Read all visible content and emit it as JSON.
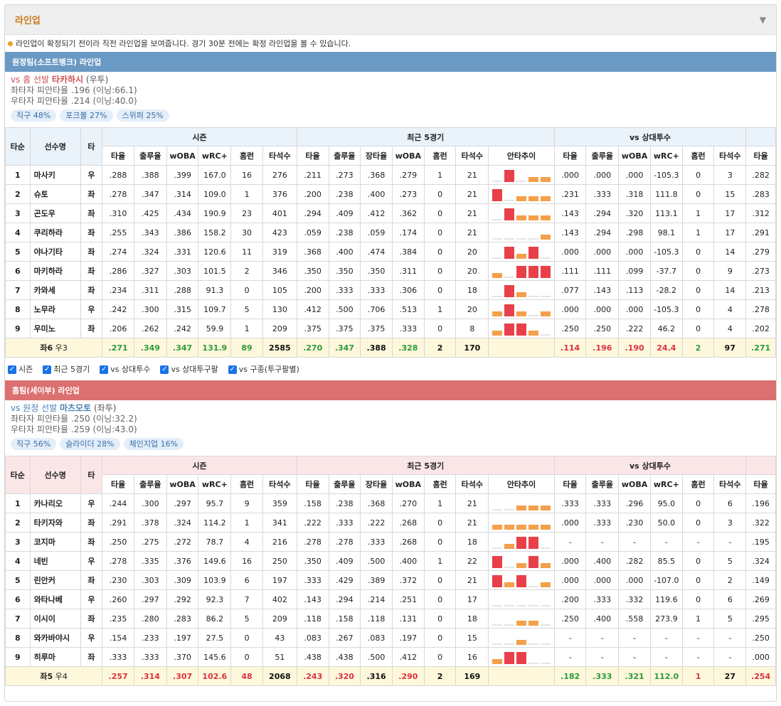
{
  "panel": {
    "title": "라인업",
    "caret": "▼"
  },
  "notice": "라인업이 확정되기 전이라 직전 라인업을 보여줍니다. 경기 30분 전에는 확정 라인업을 볼 수 있습니다.",
  "headers": {
    "order": "타순",
    "name": "선수명",
    "bat": "타",
    "season": "시즌",
    "recent": "최근 5경기",
    "vs_pitcher": "vs 상대투수",
    "season_cols": [
      "타율",
      "출루율",
      "wOBA",
      "wRC+",
      "홈런",
      "타석수"
    ],
    "recent_cols": [
      "타율",
      "출루율",
      "장타율",
      "wOBA",
      "홈런",
      "타석수",
      "안타추이"
    ],
    "vs_cols": [
      "타율",
      "출루율",
      "wOBA",
      "wRC+",
      "홈런",
      "타석수"
    ],
    "extra_col": "타율"
  },
  "colors": {
    "away_bar": "#6a99c4",
    "home_bar": "#dc7070",
    "away_head": "#eaf2fa",
    "home_head": "#fbe6e7",
    "hit_high": "#e8404a",
    "hit_low": "#f4a04a",
    "hit_zero": "#e4e4e4"
  },
  "away": {
    "bar": "원정팀(소프트뱅크) 라인업",
    "vs_prefix": "vs 홈 선발 ",
    "pitcher": "타카하시",
    "pitcher_hand": "(우투)",
    "left_line": "좌타자 피안타율 .196 (이닝:66.1)",
    "right_line": "우타자 피안타율 .214 (이닝:40.0)",
    "pills": [
      "직구 48%",
      "포크볼 27%",
      "스위퍼 25%"
    ],
    "rows": [
      [
        "1",
        "마사키",
        "우",
        ".288",
        ".388",
        ".399",
        "167.0",
        "16",
        "276",
        ".211",
        ".273",
        ".368",
        ".279",
        "1",
        "21",
        ".000",
        ".000",
        ".000",
        "-105.3",
        "0",
        "3",
        ".282"
      ],
      [
        "2",
        "슈토",
        "좌",
        ".278",
        ".347",
        ".314",
        "109.0",
        "1",
        "376",
        ".200",
        ".238",
        ".400",
        ".273",
        "0",
        "21",
        ".231",
        ".333",
        ".318",
        "111.8",
        "0",
        "15",
        ".283"
      ],
      [
        "3",
        "곤도우",
        "좌",
        ".310",
        ".425",
        ".434",
        "190.9",
        "23",
        "401",
        ".294",
        ".409",
        ".412",
        ".362",
        "0",
        "21",
        ".143",
        ".294",
        ".320",
        "113.1",
        "1",
        "17",
        ".312"
      ],
      [
        "4",
        "쿠리하라",
        "좌",
        ".255",
        ".343",
        ".386",
        "158.2",
        "30",
        "423",
        ".059",
        ".238",
        ".059",
        ".174",
        "0",
        "21",
        ".143",
        ".294",
        ".298",
        "98.1",
        "1",
        "17",
        ".291"
      ],
      [
        "5",
        "야나기타",
        "좌",
        ".274",
        ".324",
        ".331",
        "120.6",
        "11",
        "319",
        ".368",
        ".400",
        ".474",
        ".384",
        "0",
        "20",
        ".000",
        ".000",
        ".000",
        "-105.3",
        "0",
        "14",
        ".279"
      ],
      [
        "6",
        "마키하라",
        "좌",
        ".286",
        ".327",
        ".303",
        "101.5",
        "2",
        "346",
        ".350",
        ".350",
        ".350",
        ".311",
        "0",
        "20",
        ".111",
        ".111",
        ".099",
        "-37.7",
        "0",
        "9",
        ".273"
      ],
      [
        "7",
        "카와세",
        "좌",
        ".234",
        ".311",
        ".288",
        "91.3",
        "0",
        "105",
        ".200",
        ".333",
        ".333",
        ".306",
        "0",
        "18",
        ".077",
        ".143",
        ".113",
        "-28.2",
        "0",
        "14",
        ".213"
      ],
      [
        "8",
        "노무라",
        "우",
        ".242",
        ".300",
        ".315",
        "109.7",
        "5",
        "130",
        ".412",
        ".500",
        ".706",
        ".513",
        "1",
        "20",
        ".000",
        ".000",
        ".000",
        "-105.3",
        "0",
        "4",
        ".278"
      ],
      [
        "9",
        "우미노",
        "좌",
        ".206",
        ".262",
        ".242",
        "59.9",
        "1",
        "209",
        ".375",
        ".375",
        ".375",
        ".333",
        "0",
        "8",
        ".250",
        ".250",
        ".222",
        "46.2",
        "0",
        "4",
        ".202"
      ]
    ],
    "hits": [
      [
        0,
        3,
        0,
        1,
        1
      ],
      [
        3,
        0,
        1,
        1,
        1
      ],
      [
        0,
        3,
        1,
        1,
        1
      ],
      [
        0,
        0,
        0,
        0,
        1
      ],
      [
        0,
        3,
        1,
        3,
        0
      ],
      [
        1,
        0,
        3,
        3,
        3
      ],
      [
        0,
        3,
        1,
        0,
        0
      ],
      [
        1,
        3,
        1,
        0,
        1
      ],
      [
        1,
        3,
        3,
        1,
        0
      ]
    ],
    "total_label": {
      "prefix": "좌",
      "left": "6",
      "mid": " 우",
      "right": "3"
    },
    "total": [
      ".271",
      ".349",
      ".347",
      "131.9",
      "89",
      "2585",
      ".270",
      ".347",
      ".388",
      ".328",
      "2",
      "170",
      ".114",
      ".196",
      ".190",
      "24.4",
      "2",
      "97",
      ".271"
    ],
    "total_color": [
      "pos",
      "pos",
      "pos",
      "pos",
      "pos",
      "blk",
      "pos",
      "pos",
      "blk",
      "pos",
      "blk",
      "blk",
      "neg",
      "neg",
      "neg",
      "neg",
      "pos",
      "blk",
      "pos"
    ]
  },
  "checkboxes": [
    "시즌",
    "최근 5경기",
    "vs 상대투수",
    "vs 상대투구팔",
    "vs 구종(투구팔별)"
  ],
  "home": {
    "bar": "홈팀(세이부) 라인업",
    "vs_prefix": "vs 원정 선발 ",
    "pitcher": "마츠모토",
    "pitcher_hand": "(좌투)",
    "left_line": "좌타자 피안타율 .250 (이닝:32.2)",
    "right_line": "우타자 피안타율 .259 (이닝:43.0)",
    "pills": [
      "직구 56%",
      "슬라이더 28%",
      "체인지업 16%"
    ],
    "rows": [
      [
        "1",
        "카나리오",
        "우",
        ".244",
        ".300",
        ".297",
        "95.7",
        "9",
        "359",
        ".158",
        ".238",
        ".368",
        ".270",
        "1",
        "21",
        ".333",
        ".333",
        ".296",
        "95.0",
        "0",
        "6",
        ".196"
      ],
      [
        "2",
        "타키자와",
        "좌",
        ".291",
        ".378",
        ".324",
        "114.2",
        "1",
        "341",
        ".222",
        ".333",
        ".222",
        ".268",
        "0",
        "21",
        ".000",
        ".333",
        ".230",
        "50.0",
        "0",
        "3",
        ".322"
      ],
      [
        "3",
        "코지마",
        "좌",
        ".250",
        ".275",
        ".272",
        "78.7",
        "4",
        "216",
        ".278",
        ".278",
        ".333",
        ".268",
        "0",
        "18",
        "-",
        "-",
        "-",
        "-",
        "-",
        "-",
        ".195"
      ],
      [
        "4",
        "네빈",
        "우",
        ".278",
        ".335",
        ".376",
        "149.6",
        "16",
        "250",
        ".350",
        ".409",
        ".500",
        ".400",
        "1",
        "22",
        ".000",
        ".400",
        ".282",
        "85.5",
        "0",
        "5",
        ".324"
      ],
      [
        "5",
        "린안커",
        "좌",
        ".230",
        ".303",
        ".309",
        "103.9",
        "6",
        "197",
        ".333",
        ".429",
        ".389",
        ".372",
        "0",
        "21",
        ".000",
        ".000",
        ".000",
        "-107.0",
        "0",
        "2",
        ".149"
      ],
      [
        "6",
        "와타나베",
        "우",
        ".260",
        ".297",
        ".292",
        "92.3",
        "7",
        "402",
        ".143",
        ".294",
        ".214",
        ".251",
        "0",
        "17",
        ".200",
        ".333",
        ".332",
        "119.6",
        "0",
        "6",
        ".269"
      ],
      [
        "7",
        "이시이",
        "좌",
        ".235",
        ".280",
        ".283",
        "86.2",
        "5",
        "209",
        ".118",
        ".158",
        ".118",
        ".131",
        "0",
        "18",
        ".250",
        ".400",
        ".558",
        "273.9",
        "1",
        "5",
        ".295"
      ],
      [
        "8",
        "와카바야시",
        "우",
        ".154",
        ".233",
        ".197",
        "27.5",
        "0",
        "43",
        ".083",
        ".267",
        ".083",
        ".197",
        "0",
        "15",
        "-",
        "-",
        "-",
        "-",
        "-",
        "-",
        ".250"
      ],
      [
        "9",
        "히루마",
        "좌",
        ".333",
        ".333",
        ".370",
        "145.6",
        "0",
        "51",
        ".438",
        ".438",
        ".500",
        ".412",
        "0",
        "16",
        "-",
        "-",
        "-",
        "-",
        "-",
        "-",
        ".000"
      ]
    ],
    "hits": [
      [
        0,
        0,
        1,
        1,
        1
      ],
      [
        1,
        1,
        1,
        1,
        1
      ],
      [
        0,
        1,
        3,
        3,
        0
      ],
      [
        3,
        0,
        1,
        3,
        1
      ],
      [
        3,
        1,
        3,
        0,
        1
      ],
      [
        0,
        0,
        0,
        0,
        0
      ],
      [
        0,
        0,
        1,
        1,
        0
      ],
      [
        0,
        0,
        1,
        0,
        0
      ],
      [
        1,
        3,
        3,
        0,
        0
      ]
    ],
    "total_label": {
      "prefix": "좌",
      "left": "5",
      "mid": " 우",
      "right": "4"
    },
    "total": [
      ".257",
      ".314",
      ".307",
      "102.6",
      "48",
      "2068",
      ".243",
      ".320",
      ".316",
      ".290",
      "2",
      "169",
      ".182",
      ".333",
      ".321",
      "112.0",
      "1",
      "27",
      ".254"
    ],
    "total_color": [
      "neg",
      "neg",
      "neg",
      "neg",
      "neg",
      "blk",
      "neg",
      "neg",
      "blk",
      "neg",
      "blk",
      "blk",
      "pos",
      "pos",
      "pos",
      "pos",
      "neg",
      "blk",
      "neg"
    ]
  }
}
